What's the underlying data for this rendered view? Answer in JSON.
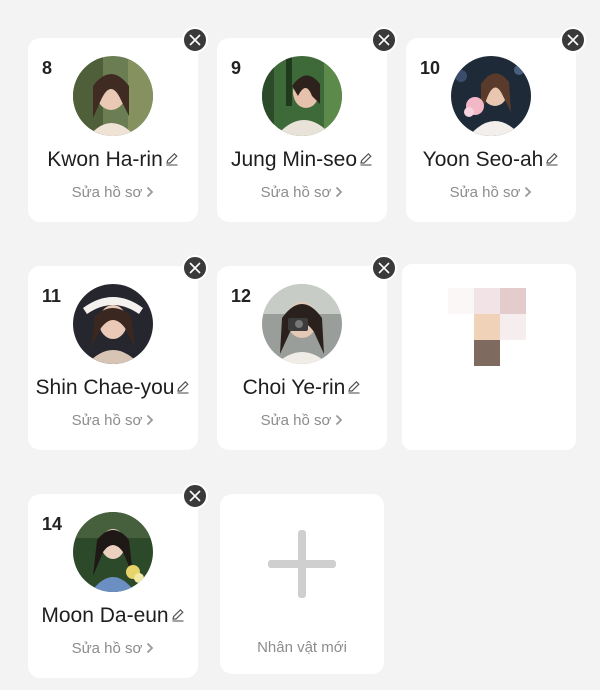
{
  "characters": [
    {
      "number": "8",
      "name": "Kwon Ha-rin",
      "edit_label": "Sửa hồ sơ"
    },
    {
      "number": "9",
      "name": "Jung Min-seo",
      "edit_label": "Sửa hồ sơ"
    },
    {
      "number": "10",
      "name": "Yoon Seo-ah",
      "edit_label": "Sửa hồ sơ"
    },
    {
      "number": "11",
      "name": "Shin Chae-you",
      "edit_label": "Sửa hồ sơ"
    },
    {
      "number": "12",
      "name": "Choi Ye-rin",
      "edit_label": "Sửa hồ sơ"
    },
    {
      "number": "14",
      "name": "Moon Da-eun",
      "edit_label": "Sửa hồ sơ"
    }
  ],
  "new_character": {
    "label": "Nhân vật mới"
  },
  "icons": {
    "close": "close-icon",
    "edit": "pencil-icon",
    "chevron": "chevron-right-icon",
    "add": "plus-icon"
  },
  "colors": {
    "background": "#f3f3f3",
    "card": "#ffffff",
    "close_button": "#3a3a3a",
    "muted_text": "#8c8c8c"
  }
}
